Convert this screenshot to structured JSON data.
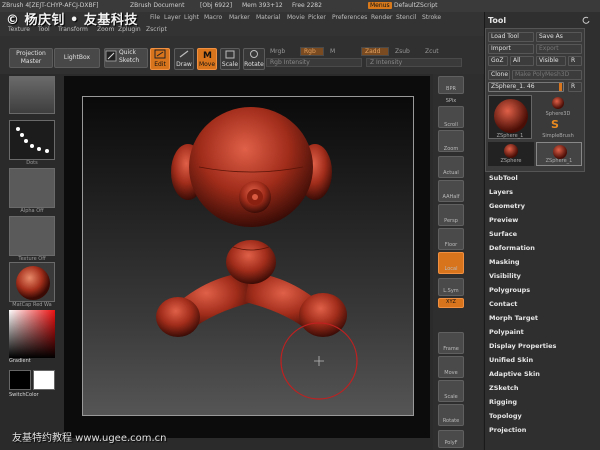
{
  "watermark": {
    "top": "© 杨庆钊 • 友基科技",
    "bottom": "友基特约教程 www.ugee.com.cn"
  },
  "titlebar": {
    "app": "ZBrush 4[ZEJT-CHYP-AFCJ-DXBF]",
    "doc": "ZBrush Document",
    "obj": "[Obj 6922]",
    "mem": "Mem 393+12",
    "free": "Free 2282",
    "menus_btn": "Menus",
    "script": "DefaultZScript"
  },
  "menus": [
    "File",
    "Layer",
    "Light",
    "Macro",
    "Marker",
    "Material",
    "Movie",
    "Picker",
    "Preferences",
    "Render",
    "Stencil",
    "Stroke"
  ],
  "menus2": [
    "Texture",
    "Tool",
    "Transform",
    "Zoom",
    "Zplugin",
    "Zscript"
  ],
  "toolbar": {
    "projection_master": "Projection Master",
    "lightbox": "LightBox",
    "quick_sketch": "Quick Sketch",
    "edit": "Edit",
    "draw": "Draw",
    "move": "Move",
    "scale": "Scale",
    "rotate": "Rotate",
    "mrgb": "Mrgb",
    "rgb": "Rgb",
    "m": "M",
    "zadd": "Zadd",
    "zsub": "Zsub",
    "zcut": "Zcut",
    "rgb_intensity": "Rgb Intensity",
    "z_intensity": "Z Intensity"
  },
  "leftshelf": {
    "dots": "Dots",
    "alpha_off": "Alpha Off",
    "texture_off": "Texture Off",
    "matcap": "MatCap Red Wa",
    "gradient": "Gradient",
    "switchcolor": "SwitchColor"
  },
  "rightshelf": [
    "BPR",
    "SPix",
    "Scroll",
    "Zoom",
    "Actual",
    "AAHalf",
    "Persp",
    "Floor",
    "Local",
    "L.Sym",
    "XYZ",
    "Frame",
    "Move",
    "Scale",
    "Rotate",
    "PolyF"
  ],
  "toolpanel": {
    "title": "Tool",
    "load_tool": "Load Tool",
    "save_as": "Save As",
    "import": "Import",
    "export": "Export",
    "goz": "GoZ",
    "all": "All",
    "visible": "Visible",
    "r": "R",
    "clone": "Clone",
    "make_polymesh": "Make PolyMesh3D",
    "current_tool": "ZSphere_1. 46",
    "thumbs": [
      "ZSphere_1",
      "Sphere3D",
      "SimpleBrush",
      "ZSphere",
      "ZSphere_1"
    ],
    "sections": [
      "SubTool",
      "Layers",
      "Geometry",
      "Preview",
      "Surface",
      "Deformation",
      "Masking",
      "Visibility",
      "Polygroups",
      "Contact",
      "Morph Target",
      "Polypaint",
      "Display Properties",
      "Unified Skin",
      "Adaptive Skin",
      "ZSketch",
      "Rigging",
      "Topology",
      "Projection"
    ]
  }
}
